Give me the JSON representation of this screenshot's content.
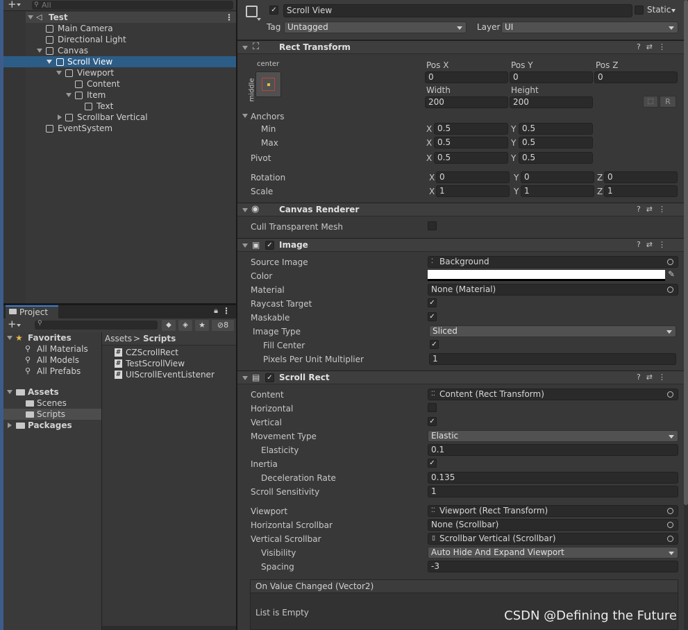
{
  "hierarchy": {
    "search_placeholder": "All",
    "items": [
      {
        "label": "Test"
      },
      {
        "label": "Main Camera"
      },
      {
        "label": "Directional Light"
      },
      {
        "label": "Canvas"
      },
      {
        "label": "Scroll View"
      },
      {
        "label": "Viewport"
      },
      {
        "label": "Content"
      },
      {
        "label": "Item"
      },
      {
        "label": "Text"
      },
      {
        "label": "Scrollbar Vertical"
      },
      {
        "label": "EventSystem"
      }
    ]
  },
  "project": {
    "tab_label": "Project",
    "hidden_count": "8",
    "tree": {
      "favorites": "Favorites",
      "all_materials": "All Materials",
      "all_models": "All Models",
      "all_prefabs": "All Prefabs",
      "assets": "Assets",
      "scenes": "Scenes",
      "scripts": "Scripts",
      "packages": "Packages"
    },
    "breadcrumb": {
      "root": "Assets",
      "sep": ">",
      "current": "Scripts"
    },
    "files": [
      "CZScrollRect",
      "TestScrollView",
      "UIScrollEventListener"
    ]
  },
  "inspector": {
    "object_name": "Scroll View",
    "static_label": "Static",
    "tag_label": "Tag",
    "tag_value": "Untagged",
    "layer_label": "Layer",
    "layer_value": "UI",
    "rect_transform": {
      "title": "Rect Transform",
      "anchor_h": "center",
      "anchor_v": "middle",
      "pos_x_label": "Pos X",
      "pos_y_label": "Pos Y",
      "pos_z_label": "Pos Z",
      "pos_x": "0",
      "pos_y": "0",
      "pos_z": "0",
      "width_label": "Width",
      "height_label": "Height",
      "width": "200",
      "height": "200",
      "r_button": "R",
      "anchors_label": "Anchors",
      "min_label": "Min",
      "max_label": "Max",
      "pivot_label": "Pivot",
      "min_x": "0.5",
      "min_y": "0.5",
      "max_x": "0.5",
      "max_y": "0.5",
      "pivot_x": "0.5",
      "pivot_y": "0.5",
      "rotation_label": "Rotation",
      "scale_label": "Scale",
      "rot_x": "0",
      "rot_y": "0",
      "rot_z": "0",
      "scale_x": "1",
      "scale_y": "1",
      "scale_z": "1",
      "x": "X",
      "y": "Y",
      "z": "Z"
    },
    "canvas_renderer": {
      "title": "Canvas Renderer",
      "cull_label": "Cull Transparent Mesh",
      "cull_checked": false
    },
    "image": {
      "title": "Image",
      "source_image_label": "Source Image",
      "source_image": "Background",
      "color_label": "Color",
      "color": "#ffffff",
      "material_label": "Material",
      "material": "None (Material)",
      "raycast_label": "Raycast Target",
      "maskable_label": "Maskable",
      "image_type_label": "Image Type",
      "image_type": "Sliced",
      "fill_center_label": "Fill Center",
      "ppu_label": "Pixels Per Unit Multiplier",
      "ppu": "1"
    },
    "scroll_rect": {
      "title": "Scroll Rect",
      "content_label": "Content",
      "content": "Content (Rect Transform)",
      "horizontal_label": "Horizontal",
      "vertical_label": "Vertical",
      "movement_label": "Movement Type",
      "movement": "Elastic",
      "elasticity_label": "Elasticity",
      "elasticity": "0.1",
      "inertia_label": "Inertia",
      "decel_label": "Deceleration Rate",
      "decel": "0.135",
      "sensitivity_label": "Scroll Sensitivity",
      "sensitivity": "1",
      "viewport_label": "Viewport",
      "viewport": "Viewport (Rect Transform)",
      "hscroll_label": "Horizontal Scrollbar",
      "hscroll": "None (Scrollbar)",
      "vscroll_label": "Vertical Scrollbar",
      "vscroll": "Scrollbar Vertical (Scrollbar)",
      "visibility_label": "Visibility",
      "visibility": "Auto Hide And Expand Viewport",
      "spacing_label": "Spacing",
      "spacing": "-3",
      "event_title": "On Value Changed (Vector2)",
      "event_empty": "List is Empty"
    }
  },
  "watermark": "CSDN @Defining the Future",
  "colors": {
    "selection": "#2c5d87",
    "panel": "#383838",
    "field": "#2a2a2a",
    "accent": "#3a7fd1"
  }
}
